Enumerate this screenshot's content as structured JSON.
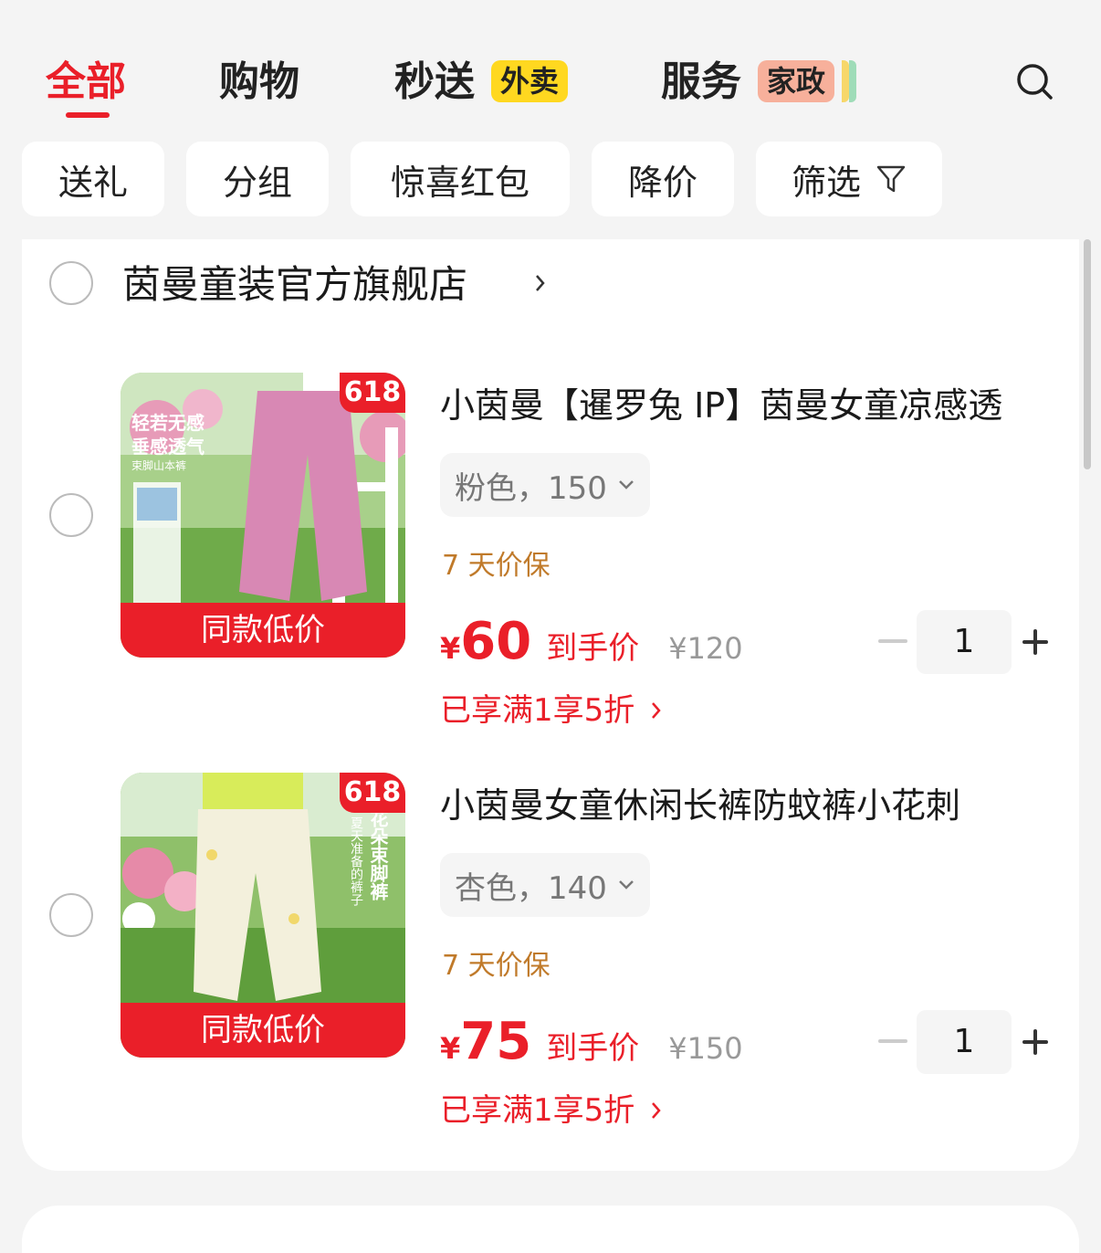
{
  "tabs": [
    {
      "label": "全部",
      "active": true
    },
    {
      "label": "购物"
    },
    {
      "label": "秒送",
      "badge": "外卖"
    },
    {
      "label": "服务",
      "badge": "家政"
    }
  ],
  "search_icon": "search-icon",
  "filters": [
    "送礼",
    "分组",
    "惊喜红包",
    "降价",
    "筛选"
  ],
  "filter_icon": "funnel-icon",
  "store": {
    "name": "茵曼童装官方旗舰店"
  },
  "items": [
    {
      "title": "小茵曼【暹罗兔 IP】茵曼女童凉感透",
      "sku": "粉色，150",
      "protection": "7 天价保",
      "currency": "¥",
      "price": "60",
      "price_label": "到手价",
      "original_price": "¥120",
      "promo": "已享满1享5折",
      "quantity": "1",
      "thumb_badge": "618",
      "thumb_banner": "同款低价",
      "thumb_text_1": "轻若无感",
      "thumb_text_2": "垂感透气",
      "thumb_text_3": "束脚山本裤",
      "thumb_color": "#d888b4"
    },
    {
      "title": "小茵曼女童休闲长裤防蚊裤小花刺",
      "sku": "杏色，140",
      "protection": "7 天价保",
      "currency": "¥",
      "price": "75",
      "price_label": "到手价",
      "original_price": "¥150",
      "promo": "已享满1享5折",
      "quantity": "1",
      "thumb_badge": "618",
      "thumb_banner": "同款低价",
      "thumb_text_1": "花朵束脚裤",
      "thumb_text_2": "夏天准备的裤子",
      "thumb_color": "#f3f0dc"
    }
  ],
  "colors": {
    "accent": "#ea1f29",
    "protect": "#c07a2a",
    "badge_yellow": "#ffd820",
    "badge_pink": "#f7b09b"
  }
}
